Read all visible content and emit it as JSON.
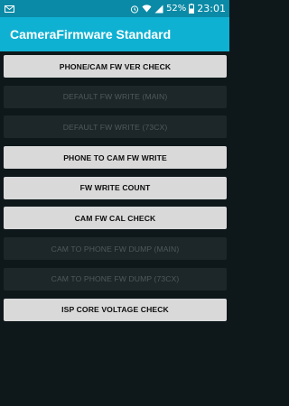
{
  "status_bar": {
    "icons_left": [
      "mail-icon"
    ],
    "icons_right": [
      "alarm-icon",
      "wifi-icon",
      "signal-icon",
      "battery-icon"
    ],
    "battery": "52%",
    "time": "23:01"
  },
  "app_bar": {
    "title": "CameraFirmware Standard"
  },
  "buttons": [
    {
      "label": "PHONE/CAM FW VER CHECK",
      "enabled": true
    },
    {
      "label": "DEFAULT FW WRITE (MAIN)",
      "enabled": false
    },
    {
      "label": "DEFAULT FW WRITE (73CX)",
      "enabled": false
    },
    {
      "label": "PHONE TO CAM FW WRITE",
      "enabled": true
    },
    {
      "label": "FW WRITE COUNT",
      "enabled": true
    },
    {
      "label": "CAM FW CAL CHECK",
      "enabled": true
    },
    {
      "label": "CAM TO PHONE FW DUMP (MAIN)",
      "enabled": false
    },
    {
      "label": "CAM TO PHONE FW DUMP (73CX)",
      "enabled": false
    },
    {
      "label": "ISP CORE VOLTAGE CHECK",
      "enabled": true
    }
  ],
  "colors": {
    "status_bar_bg": "#0a8aa6",
    "app_bar_bg": "#0fb1d3",
    "background": "#0e181b",
    "button_enabled_bg": "#d9d9d9",
    "button_disabled_bg": "#1d2628"
  }
}
